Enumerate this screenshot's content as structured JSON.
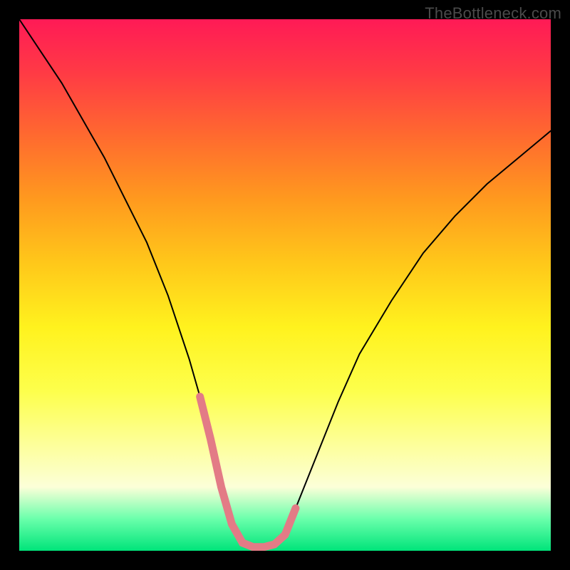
{
  "watermark": "TheBottleneck.com",
  "chart_data": {
    "type": "line",
    "title": "",
    "xlabel": "",
    "ylabel": "",
    "xlim": [
      0,
      100
    ],
    "ylim": [
      0,
      100
    ],
    "background_gradient": {
      "top": "#ff1a56",
      "middle": "#fff21e",
      "bottom": "#00e47a"
    },
    "series": [
      {
        "name": "main-curve",
        "color": "#000000",
        "stroke_width": 2,
        "x": [
          0,
          4,
          8,
          12,
          16,
          20,
          24,
          28,
          32,
          34,
          36,
          38,
          40,
          42,
          44,
          46,
          48,
          50,
          52,
          56,
          60,
          64,
          70,
          76,
          82,
          88,
          94,
          100
        ],
        "y": [
          100,
          94,
          88,
          81,
          74,
          66,
          58,
          48,
          36,
          29,
          21,
          12,
          5,
          1.5,
          0.7,
          0.7,
          1.2,
          3,
          8,
          18,
          28,
          37,
          47,
          56,
          63,
          69,
          74,
          79
        ]
      },
      {
        "name": "bottom-highlight",
        "color": "#e37b86",
        "stroke_width": 11,
        "x": [
          34,
          36,
          38,
          40,
          42,
          44,
          46,
          48,
          50,
          52
        ],
        "y": [
          29,
          21,
          12,
          5,
          1.5,
          0.7,
          0.7,
          1.2,
          3,
          8
        ]
      }
    ]
  }
}
